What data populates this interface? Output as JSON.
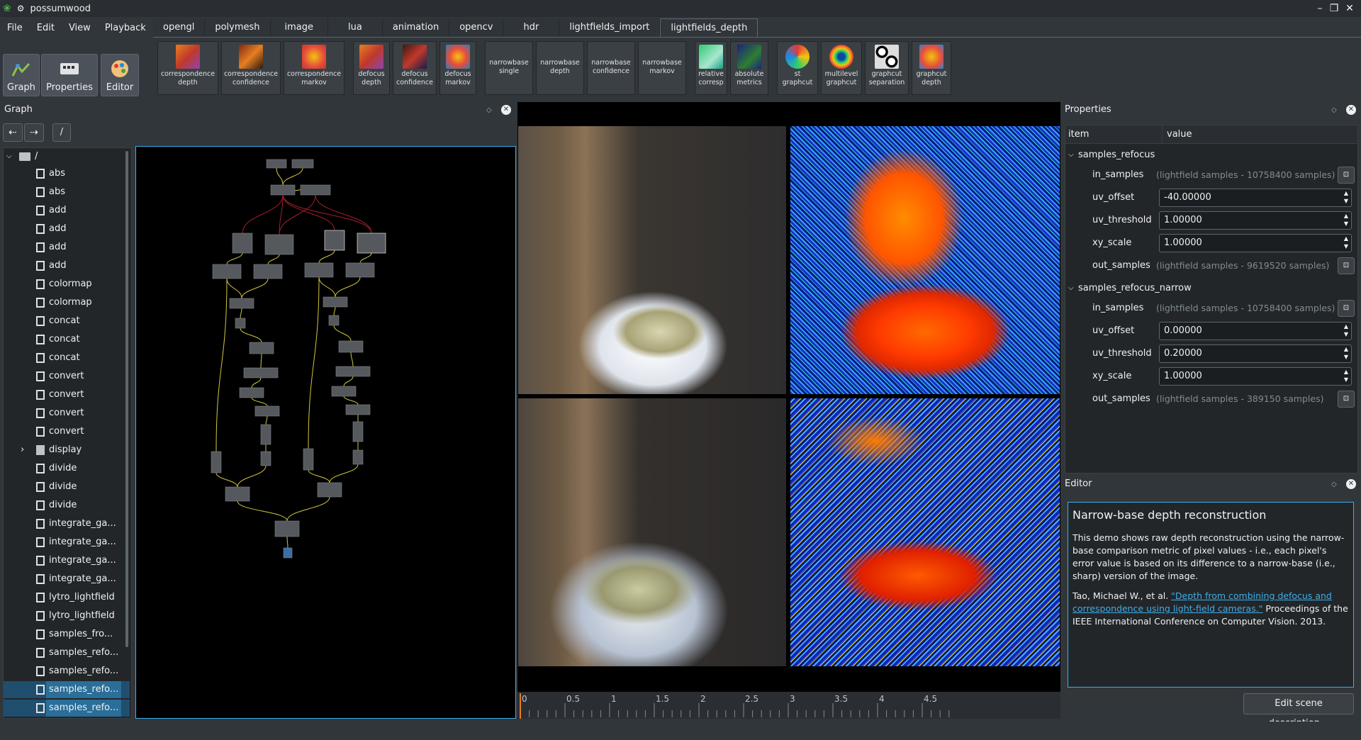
{
  "window": {
    "title": "possumwood"
  },
  "menu": [
    "File",
    "Edit",
    "View",
    "Playback"
  ],
  "left_toolbar": {
    "graph": "Graph",
    "properties": "Properties",
    "editor": "Editor"
  },
  "tabs": [
    "opengl",
    "polymesh",
    "image",
    "lua",
    "animation",
    "opencv",
    "hdr",
    "lightfields_import",
    "lightfields_depth"
  ],
  "active_tab": "lightfields_depth",
  "tools": [
    {
      "l1": "correspondence",
      "l2": "depth"
    },
    {
      "l1": "correspondence",
      "l2": "confidence"
    },
    {
      "l1": "correspondence",
      "l2": "markov"
    },
    {
      "l1": "defocus",
      "l2": "depth"
    },
    {
      "l1": "defocus",
      "l2": "confidence"
    },
    {
      "l1": "defocus",
      "l2": "markov"
    },
    {
      "l1": "narrowbase",
      "l2": "single"
    },
    {
      "l1": "narrowbase",
      "l2": "depth"
    },
    {
      "l1": "narrowbase",
      "l2": "confidence"
    },
    {
      "l1": "narrowbase",
      "l2": "markov"
    },
    {
      "l1": "relative",
      "l2": "corresp"
    },
    {
      "l1": "absolute",
      "l2": "metrics"
    },
    {
      "l1": "st",
      "l2": "graphcut"
    },
    {
      "l1": "multilevel",
      "l2": "graphcut"
    },
    {
      "l1": "graphcut",
      "l2": "separation"
    },
    {
      "l1": "graphcut",
      "l2": "depth"
    }
  ],
  "graph_panel": {
    "title": "Graph",
    "path": "/",
    "back_icon": "arrow-left-icon",
    "forward_icon": "arrow-right-icon"
  },
  "tree": {
    "root": "/",
    "items": [
      "abs",
      "abs",
      "add",
      "add",
      "add",
      "add",
      "colormap",
      "colormap",
      "concat",
      "concat",
      "concat",
      "convert",
      "convert",
      "convert",
      "convert",
      "display",
      "divide",
      "divide",
      "divide",
      "integrate_ga...",
      "integrate_ga...",
      "integrate_ga...",
      "integrate_ga...",
      "lytro_lightfield",
      "lytro_lightfield",
      "samples_fro...",
      "samples_refo...",
      "samples_refo...",
      "samples_refo...",
      "samples_refo..."
    ]
  },
  "timeline": {
    "ticks": [
      "0",
      "0.5",
      "1",
      "1.5",
      "2",
      "2.5",
      "3",
      "3.5",
      "4",
      "4.5"
    ]
  },
  "properties_panel": {
    "title": "Properties",
    "col_item": "item",
    "col_value": "value",
    "groups": [
      {
        "name": "samples_refocus",
        "rows": [
          {
            "name": "in_samples",
            "value": "(lightfield samples - 10758400 samples)"
          },
          {
            "name": "uv_offset",
            "value": "-40.00000"
          },
          {
            "name": "uv_threshold",
            "value": "1.00000"
          },
          {
            "name": "xy_scale",
            "value": "1.00000"
          },
          {
            "name": "out_samples",
            "value": "(lightfield samples - 9619520 samples)"
          }
        ]
      },
      {
        "name": "samples_refocus_narrow",
        "rows": [
          {
            "name": "in_samples",
            "value": "(lightfield samples - 10758400 samples)"
          },
          {
            "name": "uv_offset",
            "value": "0.00000"
          },
          {
            "name": "uv_threshold",
            "value": "0.20000"
          },
          {
            "name": "xy_scale",
            "value": "1.00000"
          },
          {
            "name": "out_samples",
            "value": "(lightfield samples - 389150 samples)"
          }
        ]
      }
    ]
  },
  "editor_panel": {
    "title": "Editor",
    "heading": "Narrow-base depth reconstruction",
    "para1": "This demo shows raw depth reconstruction using the narrow-base comparison metric of pixel values - i.e., each pixel's error value is based on its difference to a narrow-base (i.e., sharp) version of the image.",
    "cite_pre": "Tao, Michael W., et al. ",
    "cite_link": "\"Depth from combining defocus and correspondence using light-field cameras.\"",
    "cite_post": " Proceedings of the IEEE International Conference on Computer Vision. 2013.",
    "button": "Edit scene description..."
  },
  "colors": {
    "accent": "#3daee9",
    "bg": "#31363b",
    "panel": "#232629"
  }
}
